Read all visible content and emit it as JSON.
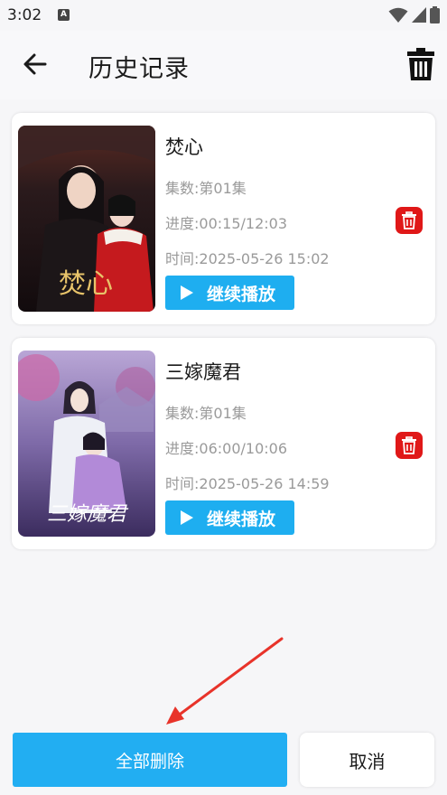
{
  "status_bar": {
    "time": "3:02",
    "notification_icon": "A"
  },
  "header": {
    "title": "历史记录"
  },
  "history": [
    {
      "title": "焚心",
      "episode": "集数:第01集",
      "progress": "进度:00:15/12:03",
      "time": "时间:2025-05-26 15:02",
      "continue_label": "继续播放",
      "poster_text": "焚心"
    },
    {
      "title": "三嫁魔君",
      "episode": "集数:第01集",
      "progress": "进度:06:00/10:06",
      "time": "时间:2025-05-26 14:59",
      "continue_label": "继续播放",
      "poster_text": "三嫁魔君"
    }
  ],
  "footer": {
    "delete_all_label": "全部删除",
    "cancel_label": "取消"
  },
  "colors": {
    "accent": "#1eaef0",
    "danger": "#e01818",
    "annotation_arrow": "#e8332a"
  }
}
